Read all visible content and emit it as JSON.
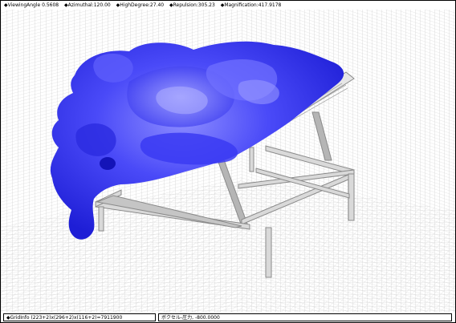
{
  "toolbar": {
    "items": [
      {
        "label": "◆ViewingAngle 0.5608"
      },
      {
        "label": "◆Azimuthal:120.00"
      },
      {
        "label": "◆HighDegree:27.40"
      },
      {
        "label": "◆Repulsion:305.23"
      },
      {
        "label": "◆Magnification:417.9178"
      }
    ]
  },
  "status": {
    "grid_info": "◆GridInfo  (223+2)x(296+2)x(116+2)=7911900",
    "voxel_info": "ボクセル-圧力, -800.0000"
  },
  "scene": {
    "blob_color": "#3d3df5",
    "blob_shadow_color": "#1616c8",
    "blob_highlight_color": "#9a9aff",
    "frame_color": "#9a9a9a",
    "grid_color": "#c7c7c7"
  }
}
